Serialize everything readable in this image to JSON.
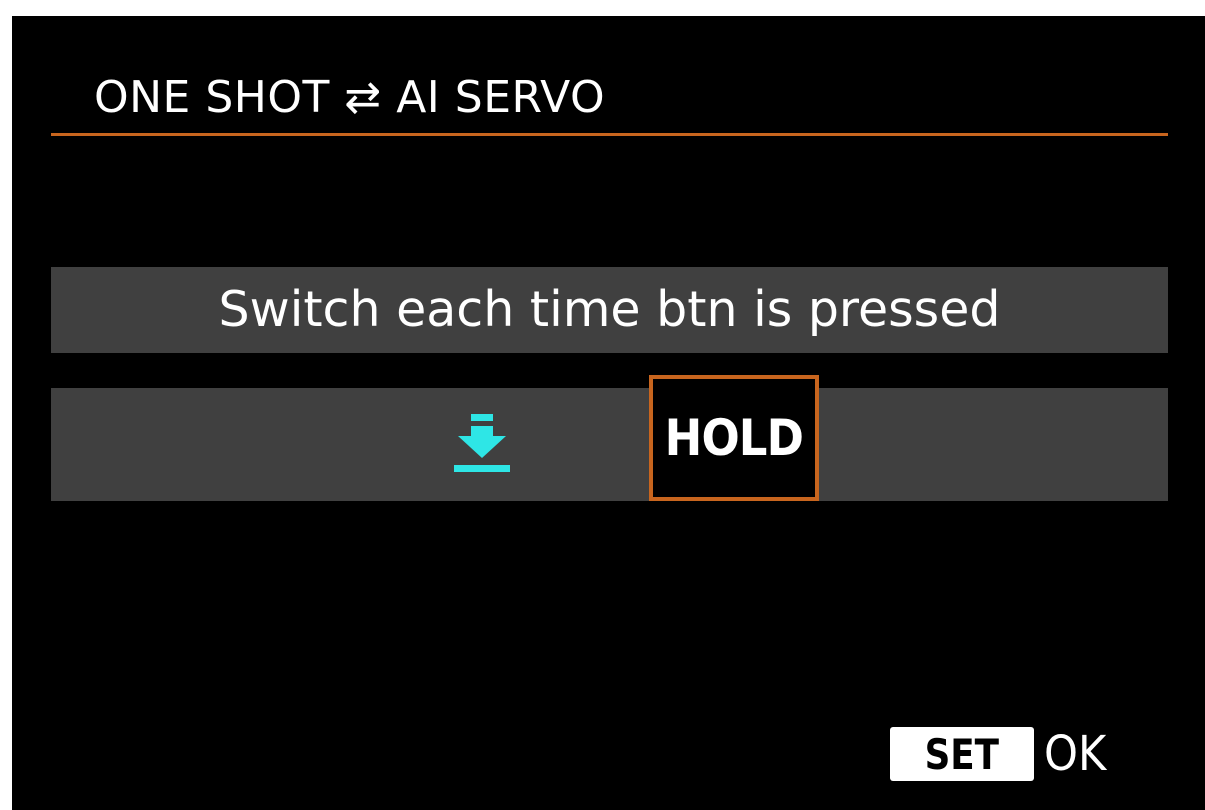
{
  "menu": {
    "title": "ONE SHOT ⇄ AI SERVO"
  },
  "options": {
    "switch_label": "Switch each time btn is pressed",
    "hold_icon": "press-hold-icon",
    "hold_label": "HOLD",
    "selected": "HOLD"
  },
  "footer": {
    "set_label": "SET",
    "ok_label": "OK"
  },
  "colors": {
    "background": "#000000",
    "title_rule": "#c8651e",
    "row_bg": "#404040",
    "selection_border": "#c8651e",
    "icon_cyan": "#2ee6e6",
    "text": "#ffffff"
  }
}
